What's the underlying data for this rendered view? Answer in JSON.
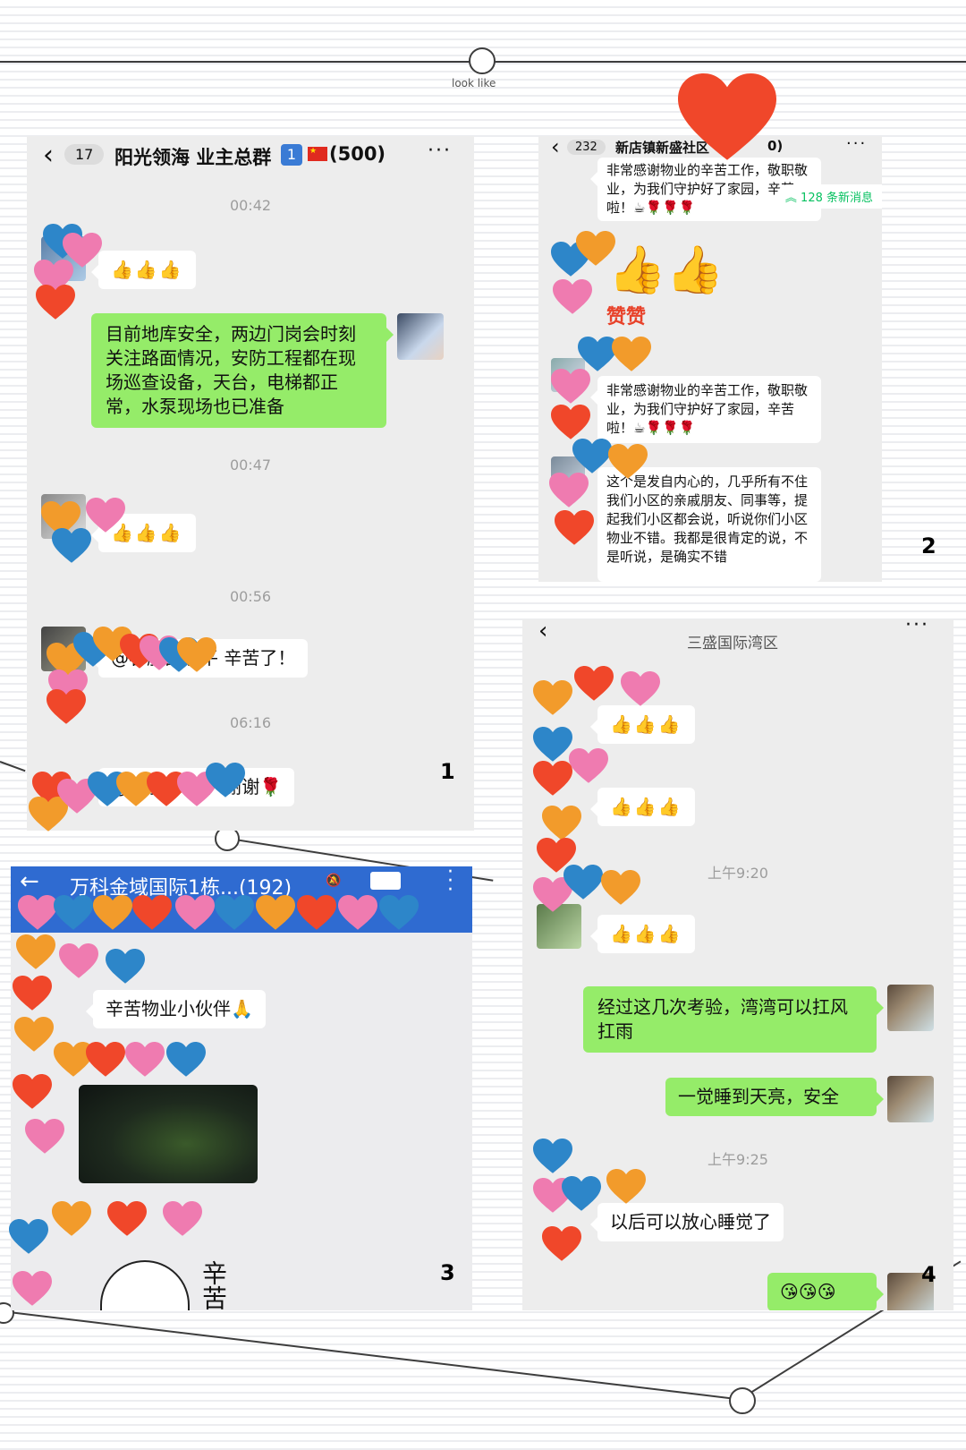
{
  "top": {
    "caption": "look like"
  },
  "panel1": {
    "number": "1",
    "back_count": "17",
    "title": "阳光领海 业主总群",
    "title_badge": "1",
    "member_count": "(500)",
    "more": "···",
    "time1": "00:42",
    "msg1": "👍👍👍",
    "msg2": "目前地库安全，两边门岗会时刻关注路面情况，安防工程都在现场巡查设备，天台，电梯都正常，水泵现场也已准备",
    "time2": "00:47",
    "msg3": "👍👍👍",
    "time3": "00:56",
    "msg4": "@客服部李平 辛苦了！",
    "time4": "06:16",
    "msg5": "@客服部李平 谢谢🌹"
  },
  "panel2": {
    "number": "2",
    "back_count": "232",
    "title": "新店镇新盛社区",
    "title_suffix": "0)",
    "more": "···",
    "new_messages": "128 条新消息",
    "msg0": "非常感谢物业的辛苦工作，敬职敬业，为我们守护好了家园，辛苦啦！☕🌹🌹🌹",
    "sticker_text": "赞赞",
    "msg1": "非常感谢物业的辛苦工作，敬职敬业，为我们守护好了家园，辛苦啦！☕🌹🌹🌹",
    "msg2": "这个是发自内心的，几乎所有不住我们小区的亲戚朋友、同事等，提起我们小区都会说，听说你们小区物业不错。我都是很肯定的说，不是听说，是确实不错"
  },
  "panel3": {
    "number": "3",
    "title": "万科金域国际1栋...(192)",
    "msg1": "辛苦物业小伙伴🙏",
    "sticker_text": "辛苦"
  },
  "panel4": {
    "number": "4",
    "subtitle": "三盛国际湾区",
    "more": "···",
    "msg1": "👍👍👍",
    "msg2": "👍👍👍",
    "time1": "上午9:20",
    "msg3": "👍👍👍",
    "msg4": "经过这几次考验，湾湾可以扛风扛雨",
    "msg5": "一觉睡到天亮，安全",
    "time2": "上午9:25",
    "msg6": "以后可以放心睡觉了",
    "msg7": "😘😘😘"
  },
  "colors": {
    "green_bubble": "#95ec69",
    "panel_bg": "#ededed",
    "blue_header": "#2f6bd1",
    "heart_red": "#f0472a",
    "heart_orange": "#f29b2b",
    "heart_blue": "#2d86c9",
    "heart_pink": "#ef7bb0"
  }
}
